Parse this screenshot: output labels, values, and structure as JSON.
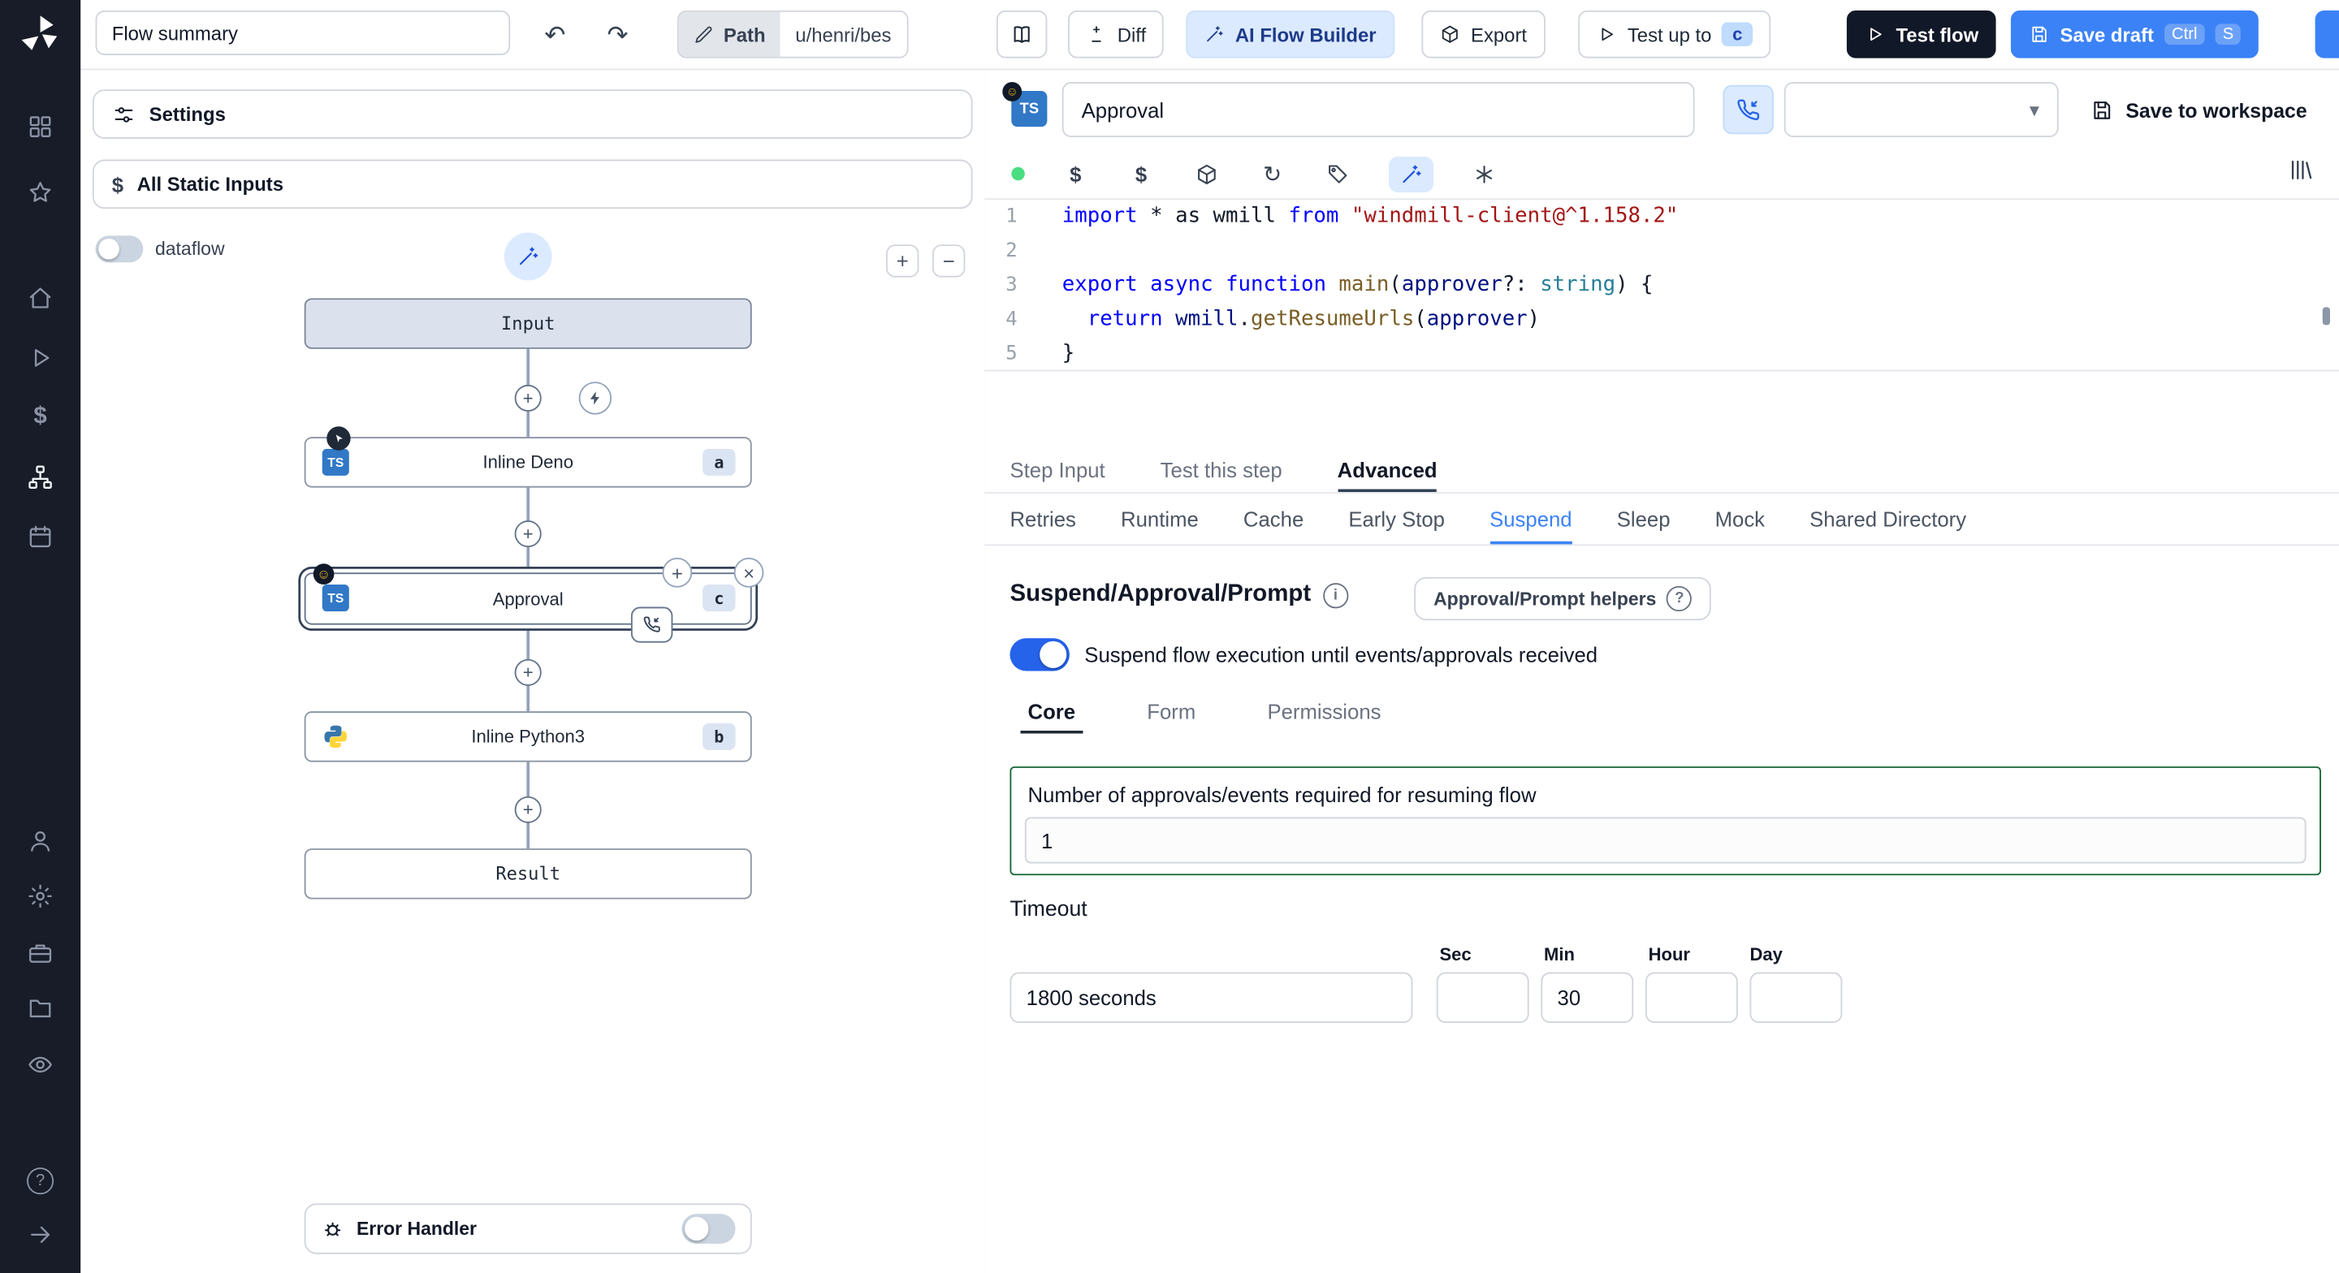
{
  "topbar": {
    "flow_summary": "Flow summary",
    "path_label": "Path",
    "path_value": "u/henri/bes",
    "diff": "Diff",
    "ai_flow_builder": "AI Flow Builder",
    "export": "Export",
    "test_up_to": "Test up to",
    "test_up_to_badge": "c",
    "test_flow": "Test flow",
    "save_draft": "Save draft",
    "kbd_ctrl": "Ctrl",
    "kbd_s": "S"
  },
  "left": {
    "settings": "Settings",
    "static_inputs": "All Static Inputs",
    "dataflow": "dataflow",
    "nodes": {
      "input": "Input",
      "deno": {
        "label": "Inline Deno",
        "badge": "a"
      },
      "approval": {
        "label": "Approval",
        "badge": "c"
      },
      "python": {
        "label": "Inline Python3",
        "badge": "b"
      },
      "result": "Result"
    },
    "error_handler": "Error Handler"
  },
  "right": {
    "step_name": "Approval",
    "save_to_workspace": "Save to workspace",
    "step_tabs": [
      {
        "label": "Step Input"
      },
      {
        "label": "Test this step"
      },
      {
        "label": "Advanced"
      }
    ],
    "advanced_tabs": [
      {
        "label": "Retries"
      },
      {
        "label": "Runtime"
      },
      {
        "label": "Cache"
      },
      {
        "label": "Early Stop"
      },
      {
        "label": "Suspend"
      },
      {
        "label": "Sleep"
      },
      {
        "label": "Mock"
      },
      {
        "label": "Shared Directory"
      }
    ],
    "suspend": {
      "heading": "Suspend/Approval/Prompt",
      "helpers_button": "Approval/Prompt helpers",
      "toggle_label": "Suspend flow execution until events/approvals received",
      "sub_tabs": [
        {
          "label": "Core"
        },
        {
          "label": "Form"
        },
        {
          "label": "Permissions"
        }
      ],
      "approvals_label": "Number of approvals/events required for resuming flow",
      "approvals_value": "1",
      "timeout_label": "Timeout",
      "timeout_value": "1800 seconds",
      "units": [
        {
          "label": "Sec",
          "value": ""
        },
        {
          "label": "Min",
          "value": "30"
        },
        {
          "label": "Hour",
          "value": ""
        },
        {
          "label": "Day",
          "value": ""
        }
      ]
    }
  },
  "editor": {
    "lines": [
      {
        "num": "1",
        "segs": [
          [
            "kw",
            "import"
          ],
          [
            "pl",
            " * as wmill "
          ],
          [
            "kw",
            "from"
          ],
          [
            "pl",
            " "
          ],
          [
            "str",
            "\"windmill-client@^1.158.2\""
          ]
        ]
      },
      {
        "num": "2",
        "segs": []
      },
      {
        "num": "3",
        "segs": [
          [
            "kw",
            "export"
          ],
          [
            "pl",
            " "
          ],
          [
            "kw",
            "async"
          ],
          [
            "pl",
            " "
          ],
          [
            "kw",
            "function"
          ],
          [
            "fn",
            " main"
          ],
          [
            "pl",
            "("
          ],
          [
            "id",
            "approver"
          ],
          [
            "pl",
            "?: "
          ],
          [
            "ty",
            "string"
          ],
          [
            "pl",
            ") {"
          ]
        ]
      },
      {
        "num": "4",
        "segs": [
          [
            "pl",
            "  "
          ],
          [
            "kw",
            "return"
          ],
          [
            "pl",
            " "
          ],
          [
            "id",
            "wmill"
          ],
          [
            "pl",
            "."
          ],
          [
            "fn",
            "getResumeUrls"
          ],
          [
            "pl",
            "("
          ],
          [
            "id",
            "approver"
          ],
          [
            "pl",
            ")"
          ]
        ]
      },
      {
        "num": "5",
        "segs": [
          [
            "pl",
            "}"
          ]
        ]
      }
    ]
  },
  "icons": {
    "undo": "↶",
    "redo": "↷",
    "plus": "+",
    "minus": "−",
    "times": "×",
    "chevron_down": "▾",
    "dollar": "$",
    "refresh": "↻",
    "question": "?",
    "info": "i",
    "ts": "TS",
    "smile": "☺"
  },
  "colors": {
    "accent": "#3b82f6",
    "save_draft": "#3b82f6",
    "dark_button": "#111827",
    "green_border": "#166534",
    "ai_button_bg": "#dbeafe"
  }
}
